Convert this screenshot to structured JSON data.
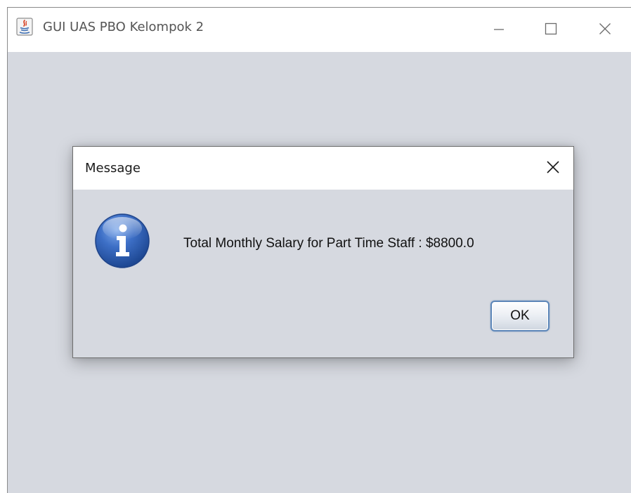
{
  "window": {
    "title": "GUI UAS PBO Kelompok 2",
    "app_icon": "java-icon",
    "controls": [
      "minimize-icon",
      "maximize-icon",
      "close-icon"
    ]
  },
  "dialog": {
    "title": "Message",
    "icon": "info-icon",
    "message": "Total Monthly Salary for Part Time Staff : $8800.0",
    "ok_label": "OK",
    "close_icon": "close-icon"
  },
  "colors": {
    "client_background": "#d6d9e0",
    "titlebar_background": "#ffffff",
    "info_icon_blue": "#2d5fb5",
    "ok_button_border": "#5c86b8"
  }
}
